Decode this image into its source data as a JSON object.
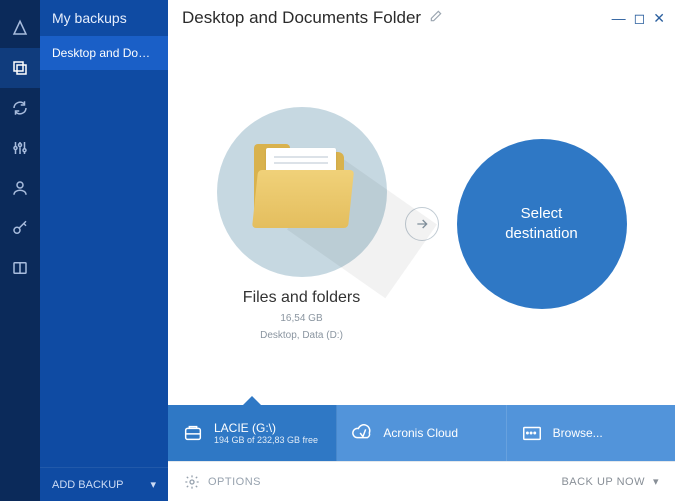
{
  "sidebar": {
    "title": "My backups",
    "items": [
      {
        "label": "Desktop and Docu..."
      }
    ],
    "add_backup": "ADD BACKUP"
  },
  "header": {
    "title": "Desktop and Documents Folder"
  },
  "source": {
    "label": "Files and folders",
    "size": "16,54 GB",
    "path": "Desktop, Data (D:)"
  },
  "destination": {
    "placeholder": "Select destination",
    "options": [
      {
        "name": "LACIE (G:\\)",
        "detail": "194 GB of 232,83 GB free"
      },
      {
        "name": "Acronis Cloud",
        "detail": ""
      },
      {
        "name": "Browse...",
        "detail": ""
      }
    ]
  },
  "footer": {
    "options": "OPTIONS",
    "backup": "BACK UP NOW"
  }
}
